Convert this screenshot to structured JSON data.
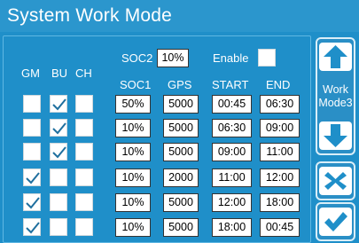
{
  "title": "System Work Mode",
  "soc2": {
    "label": "SOC2",
    "value": "10%"
  },
  "enable": {
    "label": "Enable",
    "checked": false
  },
  "check_headers": [
    "GM",
    "BU",
    "CH"
  ],
  "value_headers": [
    "SOC1",
    "GPS",
    "START",
    "END"
  ],
  "rows": [
    {
      "gm": false,
      "bu": true,
      "ch": false,
      "soc1": "50%",
      "gps": "5000",
      "start": "00:45",
      "end": "06:30"
    },
    {
      "gm": false,
      "bu": true,
      "ch": false,
      "soc1": "10%",
      "gps": "5000",
      "start": "06:30",
      "end": "09:00"
    },
    {
      "gm": false,
      "bu": true,
      "ch": false,
      "soc1": "10%",
      "gps": "5000",
      "start": "09:00",
      "end": "11:00"
    },
    {
      "gm": true,
      "bu": false,
      "ch": false,
      "soc1": "10%",
      "gps": "2000",
      "start": "11:00",
      "end": "12:00"
    },
    {
      "gm": true,
      "bu": false,
      "ch": false,
      "soc1": "10%",
      "gps": "5000",
      "start": "12:00",
      "end": "18:00"
    },
    {
      "gm": true,
      "bu": false,
      "ch": false,
      "soc1": "10%",
      "gps": "5000",
      "start": "18:00",
      "end": "00:45"
    }
  ],
  "mode": {
    "line1": "Work",
    "line2": "Mode3"
  },
  "icons": {
    "up": "arrow-up-icon",
    "down": "arrow-down-icon",
    "cancel": "close-icon",
    "confirm": "check-icon"
  },
  "colors": {
    "background": "#1f8fc9",
    "field": "#ffffff",
    "check_mark": "#1f6f9e"
  }
}
